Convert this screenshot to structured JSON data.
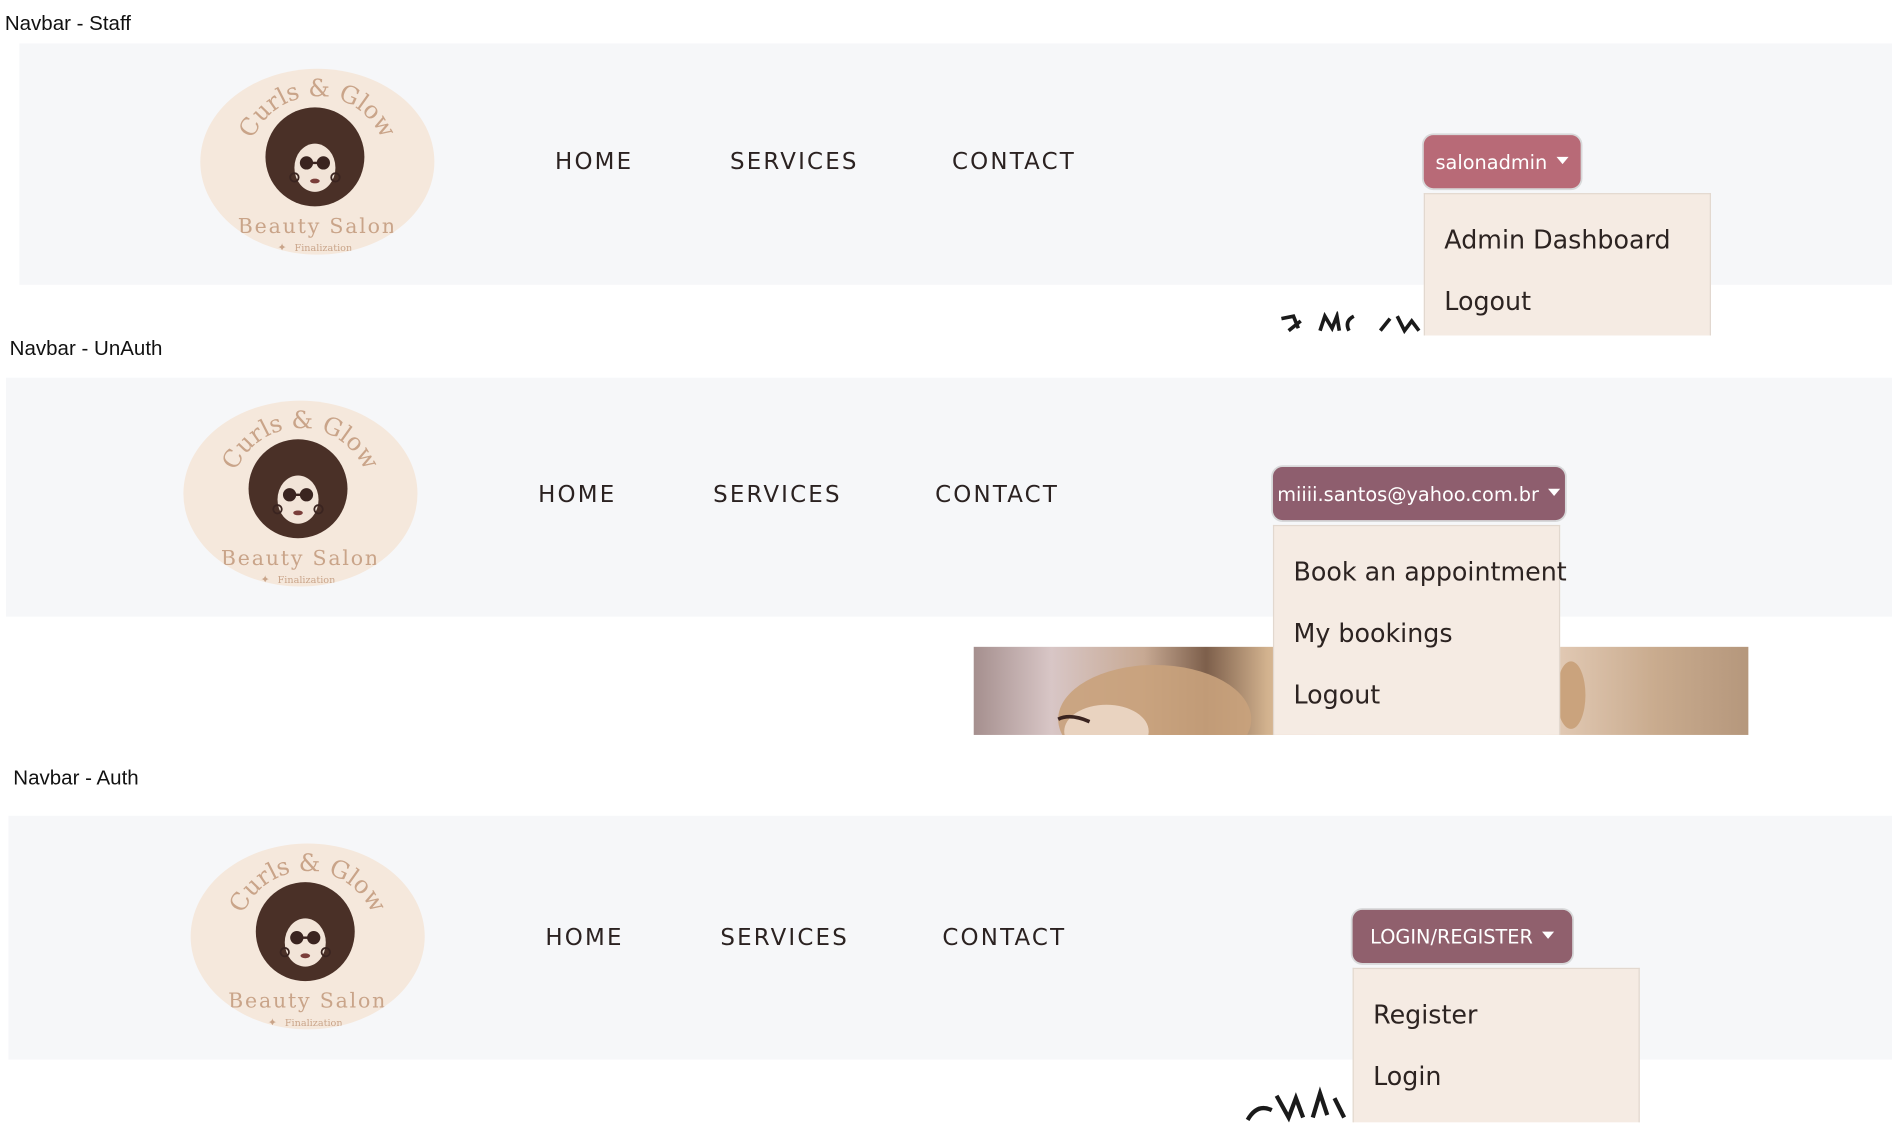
{
  "sections": [
    {
      "label": "Navbar - Staff",
      "logo": {
        "arc_text": "Curls & Glow",
        "name": "Beauty Salon",
        "tagline": "Finalization"
      },
      "nav_links": [
        "HOME",
        "SERVICES",
        "CONTACT"
      ],
      "dropdown": {
        "toggle_label": "salonadmin",
        "items": [
          "Admin Dashboard",
          "Logout"
        ]
      }
    },
    {
      "label": "Navbar - UnAuth",
      "logo": {
        "arc_text": "Curls & Glow",
        "name": "Beauty Salon",
        "tagline": "Finalization"
      },
      "nav_links": [
        "HOME",
        "SERVICES",
        "CONTACT"
      ],
      "dropdown": {
        "toggle_label": "miiii.santos@yahoo.com.br",
        "items": [
          "Book an appointment",
          "My bookings",
          "Logout"
        ]
      }
    },
    {
      "label": "Navbar - Auth",
      "logo": {
        "arc_text": "Curls & Glow",
        "name": "Beauty Salon",
        "tagline": "Finalization"
      },
      "nav_links": [
        "HOME",
        "SERVICES",
        "CONTACT"
      ],
      "dropdown": {
        "toggle_label": "LOGIN/REGISTER",
        "items": [
          "Register",
          "Login"
        ]
      }
    }
  ],
  "colors": {
    "navbar_bg": "#f6f7f9",
    "logo_bg": "#f5e8dc",
    "logo_gold": "#c9a489",
    "hair": "#4a3027",
    "staff_button": "#b86a77",
    "user_button": "#8e5e6e",
    "login_button": "#90606d",
    "dropdown_bg": "#f5ebe3",
    "nav_text": "#2b2221"
  },
  "icons": {
    "caret": "caret-down-icon",
    "logo_face": "afro-woman-sunglasses-icon",
    "sparkle": "sparkle-icon"
  }
}
